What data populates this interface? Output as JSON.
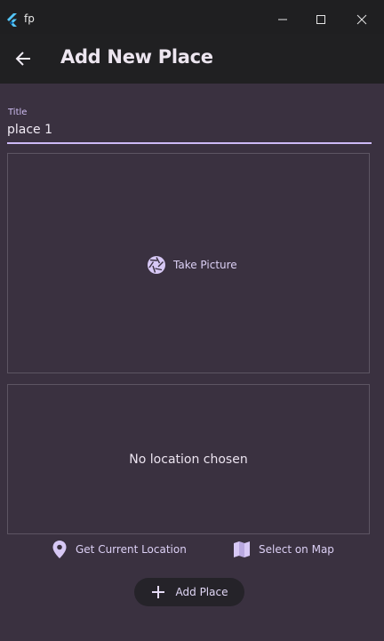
{
  "window": {
    "title": "fp",
    "logo_icon": "flutter-logo",
    "minimize_icon": "minimize-icon",
    "maximize_icon": "maximize-icon",
    "close_icon": "close-icon"
  },
  "appbar": {
    "title": "Add New Place",
    "back_icon": "arrow-back-icon"
  },
  "form": {
    "title_label": "Title",
    "title_value": "place 1"
  },
  "picture": {
    "button_label": "Take Picture",
    "icon": "camera-aperture-icon"
  },
  "location": {
    "empty_text": "No location chosen",
    "current_location_label": "Get Current Location",
    "current_location_icon": "location-pin-icon",
    "select_map_label": "Select on Map",
    "select_map_icon": "map-icon"
  },
  "actions": {
    "add_place_label": "Add Place",
    "add_place_icon": "plus-icon"
  },
  "colors": {
    "background": "#3a3140",
    "appbar": "#202022",
    "accent": "#cdb9f6",
    "button_bg": "#252329"
  }
}
